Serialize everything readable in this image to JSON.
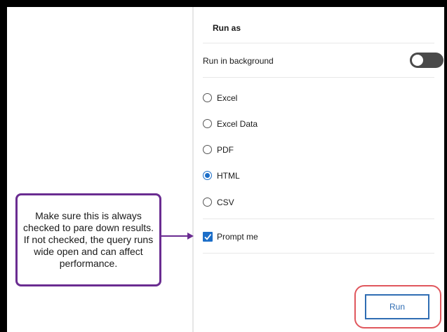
{
  "panel": {
    "title": "Run as",
    "background": {
      "label": "Run in background",
      "enabled": false
    },
    "formats": [
      {
        "label": "Excel",
        "selected": false
      },
      {
        "label": "Excel Data",
        "selected": false
      },
      {
        "label": "PDF",
        "selected": false
      },
      {
        "label": "HTML",
        "selected": true
      },
      {
        "label": "CSV",
        "selected": false
      }
    ],
    "prompt": {
      "label": "Prompt me",
      "checked": true
    },
    "run_label": "Run"
  },
  "callout": {
    "text": "Make sure this is always checked to pare down results.  If not checked, the query runs wide open and can affect performance."
  },
  "colors": {
    "accent": "#1c6ec8",
    "callout_border": "#6a2c91",
    "highlight_outline": "#e0575d"
  }
}
